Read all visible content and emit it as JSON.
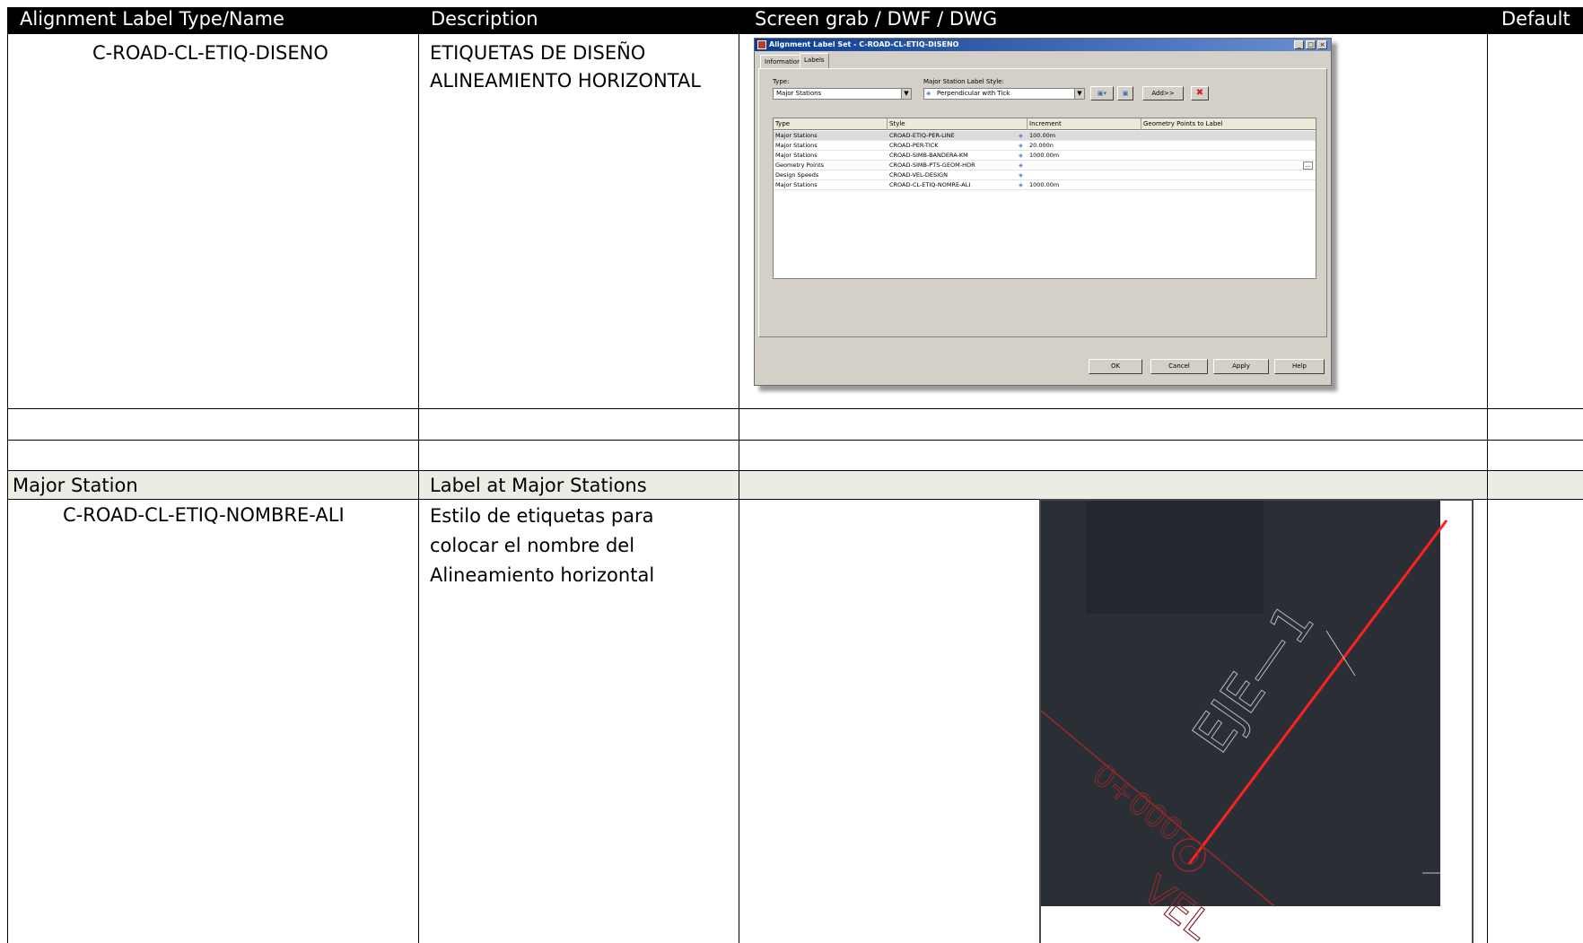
{
  "header": {
    "col1": "Alignment Label Type/Name",
    "col2": "Description",
    "col3": "Screen grab / DWF / DWG",
    "col4": "Default"
  },
  "row1": {
    "name": "C-ROAD-CL-ETIQ-DISENO",
    "description_line1": "ETIQUETAS DE DISEÑO",
    "description_line2": "ALINEAMIENTO HORIZONTAL"
  },
  "dialog": {
    "title": "Alignment Label Set - C-ROAD-CL-ETIQ-DISENO",
    "tabs": [
      "Information",
      "Labels"
    ],
    "type_label": "Type:",
    "type_value": "Major Stations",
    "style_label": "Major Station Label Style:",
    "style_value": "Perpendicular with Tick",
    "add_button": "Add>>",
    "columns": [
      "Type",
      "Style",
      "Increment",
      "Geometry Points to Label"
    ],
    "rows": [
      {
        "type": "Major Stations",
        "style": "CROAD-ETIQ-PER-LINE",
        "increment": "100.00m"
      },
      {
        "type": "Major Stations",
        "style": "CROAD-PER-TICK",
        "increment": "20.000n"
      },
      {
        "type": "Major Stations",
        "style": "CROAD-SIMB-BANDERA-KM",
        "increment": "1000.00m"
      },
      {
        "type": "Geometry Points",
        "style": "CROAD-SIMB-PTS-GEOM-HOR",
        "increment": ""
      },
      {
        "type": "Design Speeds",
        "style": "CROAD-VEL-DESIGN",
        "increment": ""
      },
      {
        "type": "Major Stations",
        "style": "CROAD-CL-ETIQ-NOMRE-ALI",
        "increment": "1000.00m"
      }
    ],
    "buttons": [
      "OK",
      "Cancel",
      "Apply",
      "Help"
    ]
  },
  "section": {
    "col1": "Major Station",
    "col2": "Label at Major Stations"
  },
  "row2": {
    "name": "C-ROAD-CL-ETIQ-NOMBRE-ALI",
    "description_line1": "Estilo de etiquetas para",
    "description_line2": "colocar el nombre del",
    "description_line3": "Alineamiento horizontal"
  },
  "cad": {
    "alignment_label": "EJE—1",
    "station_label": "0+000",
    "speed_label": "VEL",
    "background": "#2a2f36",
    "alignment_color": "#ff2020",
    "tick_color": "#c0c0c0"
  }
}
